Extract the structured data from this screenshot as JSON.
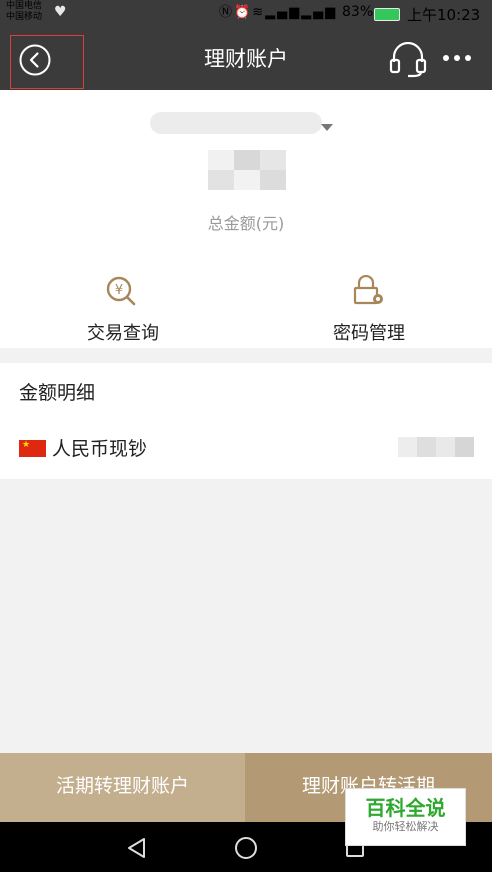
{
  "status_bar": {
    "carrier1": "中国电信",
    "carrier2": "中国移动",
    "battery_pct": "83%",
    "time": "上午10:23",
    "icons": [
      "heart-icon",
      "nfc-icon",
      "alarm-icon",
      "wifi-icon",
      "signal-4g-icon",
      "signal-2g-icon",
      "battery-icon"
    ]
  },
  "header": {
    "title": "理财账户",
    "back_icon": "back-circle-icon",
    "service_icon": "headset-icon",
    "more_icon": "more-icon"
  },
  "summary": {
    "total_label": "总金额(元)",
    "actions": [
      {
        "label": "交易查询",
        "icon": "search-coin-icon"
      },
      {
        "label": "密码管理",
        "icon": "lock-gear-icon"
      }
    ]
  },
  "details": {
    "title": "金额明细",
    "rows": [
      {
        "currency": "人民币现钞",
        "flag": "china-flag-icon"
      }
    ]
  },
  "bottom": {
    "btn_left": "活期转理财账户",
    "btn_right": "理财账户转活期"
  },
  "watermark": {
    "title": "百科全说",
    "subtitle": "助你轻松解决"
  },
  "colors": {
    "header_bg": "#3b3b3b",
    "accent_gold": "#a8865a",
    "btn_left_bg": "#c3ae8e",
    "btn_right_bg": "#b39a74",
    "highlight_red": "#d9403a"
  }
}
